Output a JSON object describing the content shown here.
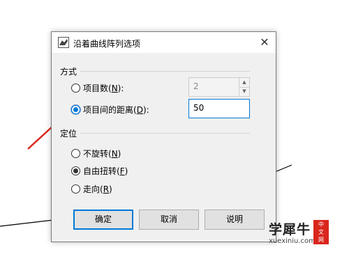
{
  "dialog": {
    "title": "沿着曲线阵列选项",
    "close_glyph": "✕"
  },
  "method": {
    "title": "方式",
    "count": {
      "label": "项目数(",
      "key": "N",
      "suffix": "):",
      "value": "2"
    },
    "distance": {
      "label": "项目间的距离(",
      "key": "D",
      "suffix": "):",
      "value": "50"
    }
  },
  "orientation": {
    "title": "定位",
    "options": [
      {
        "label": "不旋转(",
        "key": "N",
        "suffix": ")"
      },
      {
        "label": "自由扭转(",
        "key": "F",
        "suffix": ")"
      },
      {
        "label": "走向(",
        "key": "R",
        "suffix": ")"
      }
    ]
  },
  "buttons": {
    "ok": "确定",
    "cancel": "取消",
    "help": "说明"
  },
  "watermark": {
    "main": "学犀牛",
    "url": "xuexiniu.com",
    "badge": [
      "中",
      "文",
      "网"
    ]
  },
  "colors": {
    "accent": "#0078d7",
    "arrow": "#d9261c"
  }
}
